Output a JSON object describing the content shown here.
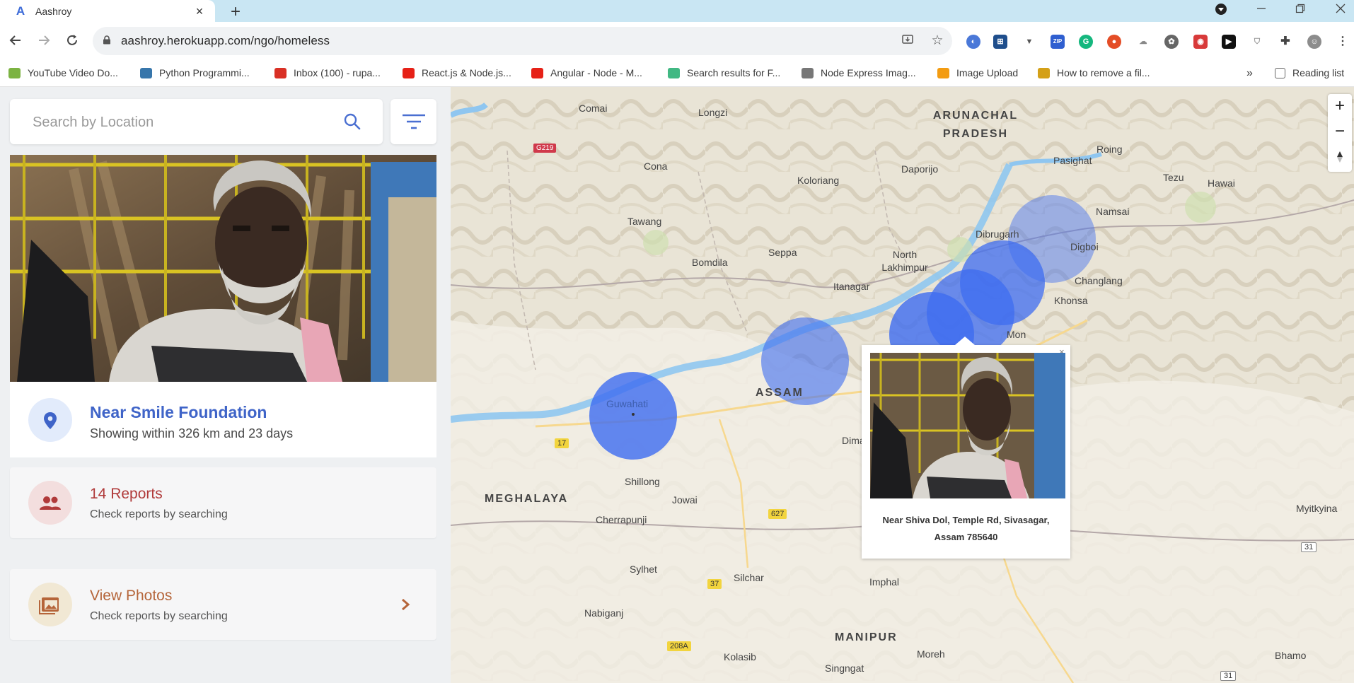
{
  "browser": {
    "tab_title": "Aashroy",
    "tab_favicon": "A",
    "tab_close": "×",
    "new_tab": "+",
    "url": "aashroy.herokuapp.com/ngo/homeless",
    "bookmarks": [
      {
        "label": "YouTube Video Do...",
        "icon": "leaf-icon",
        "color": "#7cb342"
      },
      {
        "label": "Python Programmi...",
        "icon": "python-icon",
        "color": "#3776ab"
      },
      {
        "label": "Inbox (100) - rupa...",
        "icon": "gmail-icon",
        "color": "#d93025"
      },
      {
        "label": "React.js & Node.js...",
        "icon": "youtube-icon",
        "color": "#e62117"
      },
      {
        "label": "Angular - Node - M...",
        "icon": "youtube-icon",
        "color": "#e62117"
      },
      {
        "label": "Search results for F...",
        "icon": "vue-icon",
        "color": "#41b883"
      },
      {
        "label": "Node Express Imag...",
        "icon": "image-icon",
        "color": "#777777"
      },
      {
        "label": "Image Upload",
        "icon": "bookmark-icon",
        "color": "#f39c12"
      },
      {
        "label": "How to remove a fil...",
        "icon": "emoji-icon",
        "color": "#d4a017"
      }
    ],
    "bookmarks_more": "»",
    "reading_list": "Reading list"
  },
  "sidebar": {
    "search_placeholder": "Search by Location",
    "info": {
      "title": "Near Smile Foundation",
      "subtitle": "Showing within 326 km and 23 days"
    },
    "reports": {
      "title": "14 Reports",
      "subtitle": "Check reports by searching"
    },
    "photos": {
      "title": "View Photos",
      "subtitle": "Check reports by searching"
    }
  },
  "map": {
    "regions": [
      {
        "text": "ARUNACHAL PRADESH"
      },
      {
        "text": "ASSAM"
      },
      {
        "text": "MEGHALAYA"
      },
      {
        "text": "MANIPUR"
      }
    ],
    "places": [
      "Comai",
      "Longzi",
      "Cona",
      "Koloriang",
      "Daporijo",
      "Pasighat",
      "Roing",
      "Tezu",
      "Hawai",
      "Tawang",
      "Namsai",
      "Dibrugarh",
      "Digboi",
      "Bomdila",
      "Seppa",
      "North Lakhimpur",
      "Itanagar",
      "Changlang",
      "Khonsa",
      "Mon",
      "Guwahati",
      "Dimapur",
      "Shillong",
      "Jowai",
      "Cherrapunji",
      "Sylhet",
      "Silchar",
      "Imphal",
      "Nabiganj",
      "Kolasib",
      "Moreh",
      "Singngat",
      "Myitkyina",
      "Bhamo"
    ],
    "road_badges": [
      "G219",
      "17",
      "627",
      "37",
      "208A",
      "31",
      "31"
    ],
    "zoom_in": "+",
    "zoom_out": "−",
    "popup": {
      "close": "×",
      "address": "Near Shiva Dol, Temple Rd, Sivasagar, Assam 785640"
    }
  },
  "colors": {
    "accent": "#3f64c8",
    "cluster": "#3d6cf0",
    "reports": "#b03a3a",
    "photos": "#b5653a"
  }
}
